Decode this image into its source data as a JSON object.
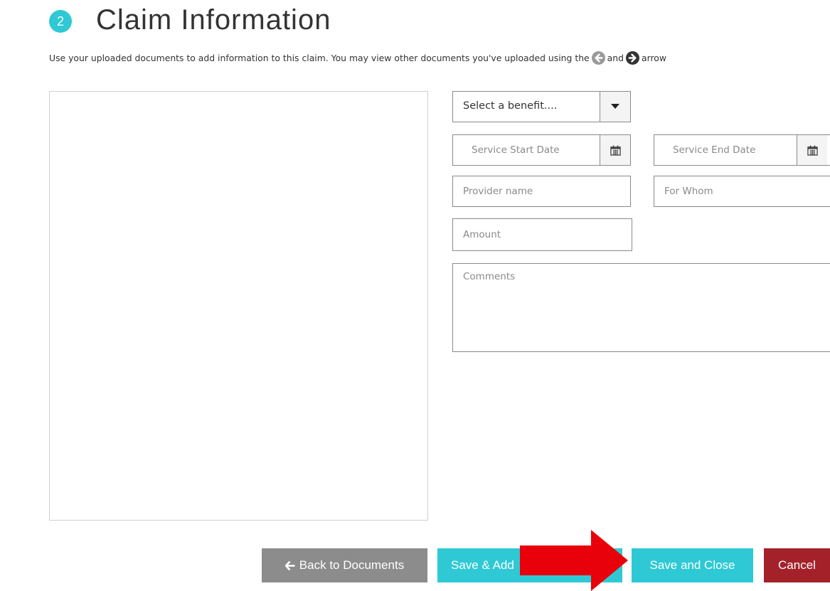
{
  "header": {
    "step_number": "2",
    "title": "Claim Information",
    "instructions_before": "Use your uploaded documents to add information to this claim. You may view other documents you've uploaded using the",
    "instructions_and": "and",
    "instructions_after": "arrow"
  },
  "form": {
    "benefit_select_label": "Select a benefit....",
    "service_start_placeholder": "Service Start Date",
    "service_end_placeholder": "Service End Date",
    "provider_placeholder": "Provider name",
    "for_whom_placeholder": "For Whom",
    "amount_placeholder": "Amount",
    "comments_placeholder": "Comments"
  },
  "buttons": {
    "back_label": "Back to Documents",
    "save_add_label": "Save & Add",
    "save_close_label": "Save and Close",
    "cancel_label": "Cancel"
  },
  "colors": {
    "accent": "#2ec9d4",
    "back_button": "#8c8c8c",
    "cancel_button": "#a4212a",
    "annotation_arrow": "#e8000b"
  },
  "icons": {
    "prev_arrow": "arrow-left-circle-icon",
    "next_arrow": "arrow-right-circle-icon",
    "calendar": "calendar-icon",
    "dropdown": "caret-down-icon",
    "back": "arrow-left-icon"
  }
}
